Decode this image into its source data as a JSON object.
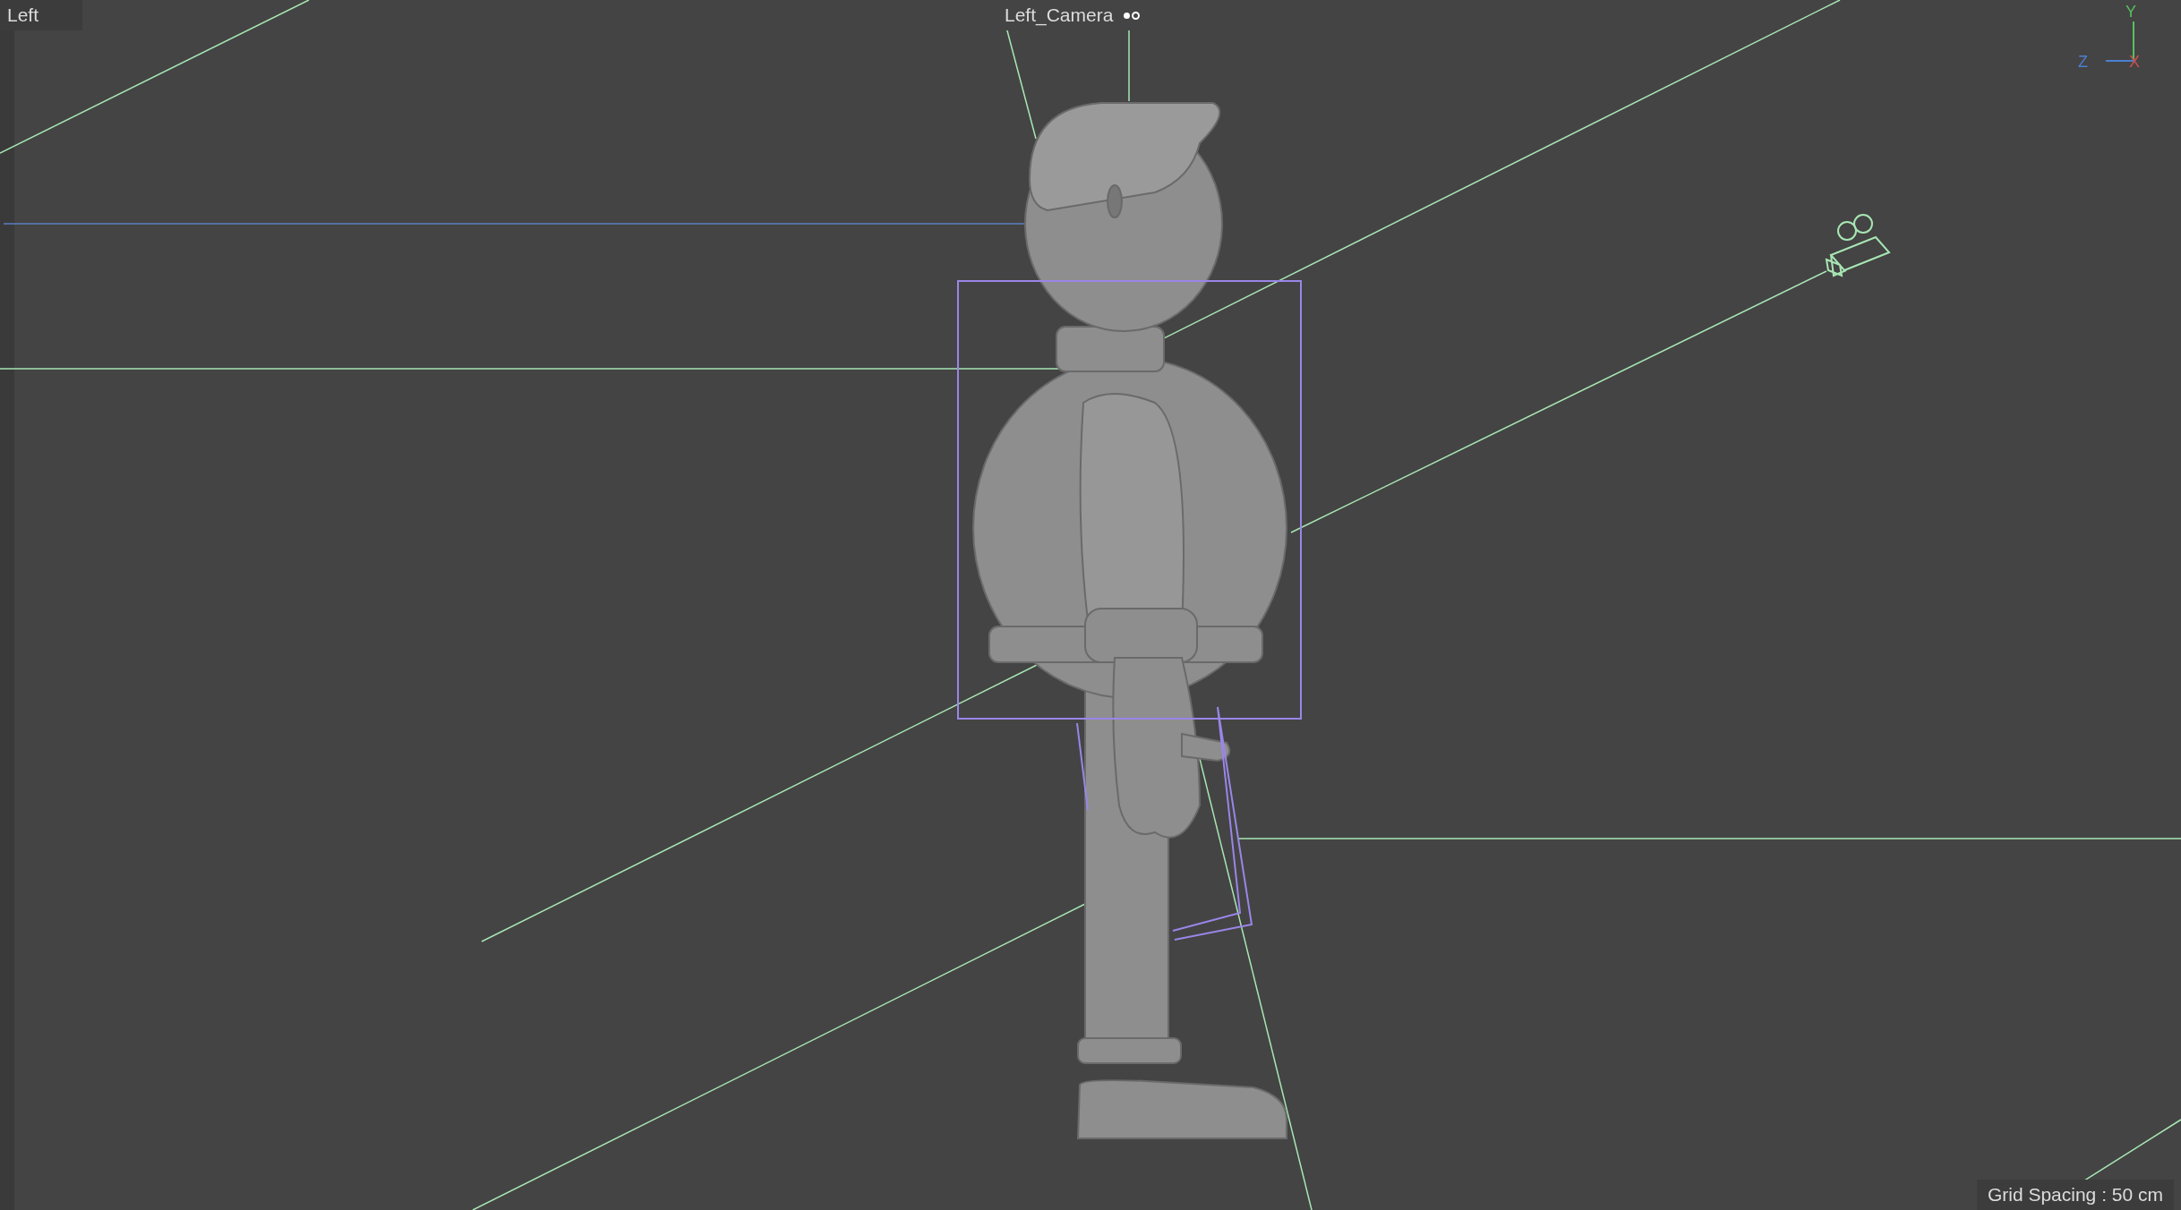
{
  "viewport": {
    "view_name": "Left",
    "camera_name": "Left_Camera",
    "axes": {
      "y": "Y",
      "z": "Z",
      "x": "X"
    },
    "grid_spacing": "Grid Spacing : 50 cm"
  }
}
